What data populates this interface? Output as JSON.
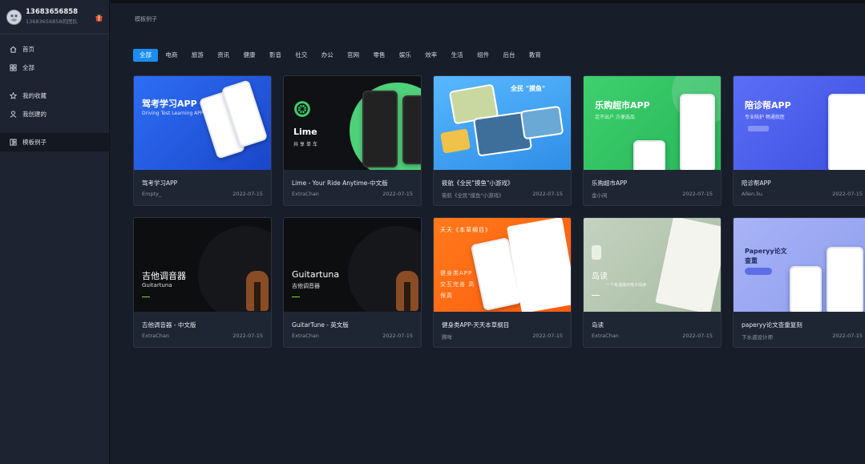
{
  "profile": {
    "name": "13683656858",
    "team": "13683656858的团队"
  },
  "nav": {
    "home": "首页",
    "all": "全部",
    "favorites": "我的收藏",
    "created": "我创建的",
    "templates": "模板例子"
  },
  "breadcrumb": "模板例子",
  "tabs": [
    "全部",
    "电商",
    "旅游",
    "资讯",
    "健康",
    "影音",
    "社交",
    "办公",
    "官网",
    "零售",
    "娱乐",
    "效率",
    "生活",
    "组件",
    "后台",
    "教育"
  ],
  "cards": [
    {
      "title": "驾考学习APP",
      "author": "Empty_",
      "date": "2022-07-15",
      "thumb_title": "驾考学习APP",
      "thumb_sub": "Driving Test Learning APP"
    },
    {
      "title": "Lime - Your Ride Anytime-中文版",
      "author": "ExtraChan",
      "date": "2022-07-15",
      "thumb_title": "Lime",
      "thumb_sub": "共享单车"
    },
    {
      "title": "筱航《全民\"摸鱼\"小游戏》",
      "author": "筱航《全民\"摸鱼\"小游戏》",
      "date": "2022-07-15",
      "thumb_title": "全民 \"摸鱼\"",
      "thumb_sub": ""
    },
    {
      "title": "乐购超市APP",
      "author": "金小闲",
      "date": "2022-07-15",
      "thumb_title": "乐购超市APP",
      "thumb_sub": "足不出户 方便选品"
    },
    {
      "title": "陪诊帮APP",
      "author": "Allen.liu",
      "date": "2022-07-15",
      "thumb_title": "陪诊帮APP",
      "thumb_sub": "专业陪护 畅通就医"
    },
    {
      "title": "吉他调音器 - 中文版",
      "author": "ExtraChan",
      "date": "2022-07-15",
      "thumb_title": "吉他调音器",
      "thumb_sub": "Guitartuna"
    },
    {
      "title": "GuitarTune - 英文版",
      "author": "ExtraChan",
      "date": "2022-07-15",
      "thumb_title": "Guitartuna",
      "thumb_sub": "吉他调音器"
    },
    {
      "title": "健身类APP-天天本草纲目",
      "author": "腾咩",
      "date": "2022-07-15",
      "thumb_title": "天天《本草纲目》",
      "thumb_sub": "健身类APP 交互完善 高保真"
    },
    {
      "title": "岛读",
      "author": "ExtraChan",
      "date": "2022-07-15",
      "thumb_title": "岛读",
      "thumb_sub": "一个有温度的电子阅读"
    },
    {
      "title": "paperyy论文查重复刻",
      "author": "下水道设计师",
      "date": "2022-07-15",
      "thumb_title": "Paperyy论文查重",
      "thumb_sub": ""
    }
  ],
  "colors": {
    "accent": "#1a8df2",
    "sidebar_bg": "#1d2330",
    "main_bg": "#181e29"
  }
}
